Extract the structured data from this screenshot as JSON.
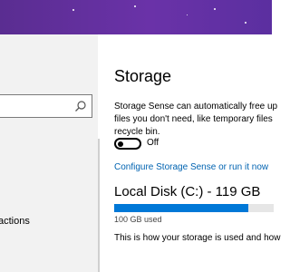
{
  "colors": {
    "wallpaper": "#5a2d91",
    "accent": "#0078d7",
    "link": "#0063b1",
    "sidebar_bg": "#f2f2f2"
  },
  "sidebar": {
    "search_icon": "search-icon",
    "partial_item_label": "actions"
  },
  "main": {
    "title": "Storage",
    "description": "Storage Sense can automatically free up files you don't need, like temporary files recycle bin.",
    "toggle": {
      "state_label": "Off",
      "on": false
    },
    "configure_link": "Configure Storage Sense or run it now",
    "disk": {
      "title": "Local Disk (C:) - 119 GB",
      "used_label": "100 GB used",
      "used_fraction": 0.84
    },
    "bottom_text": "This is how your storage is used and how"
  }
}
